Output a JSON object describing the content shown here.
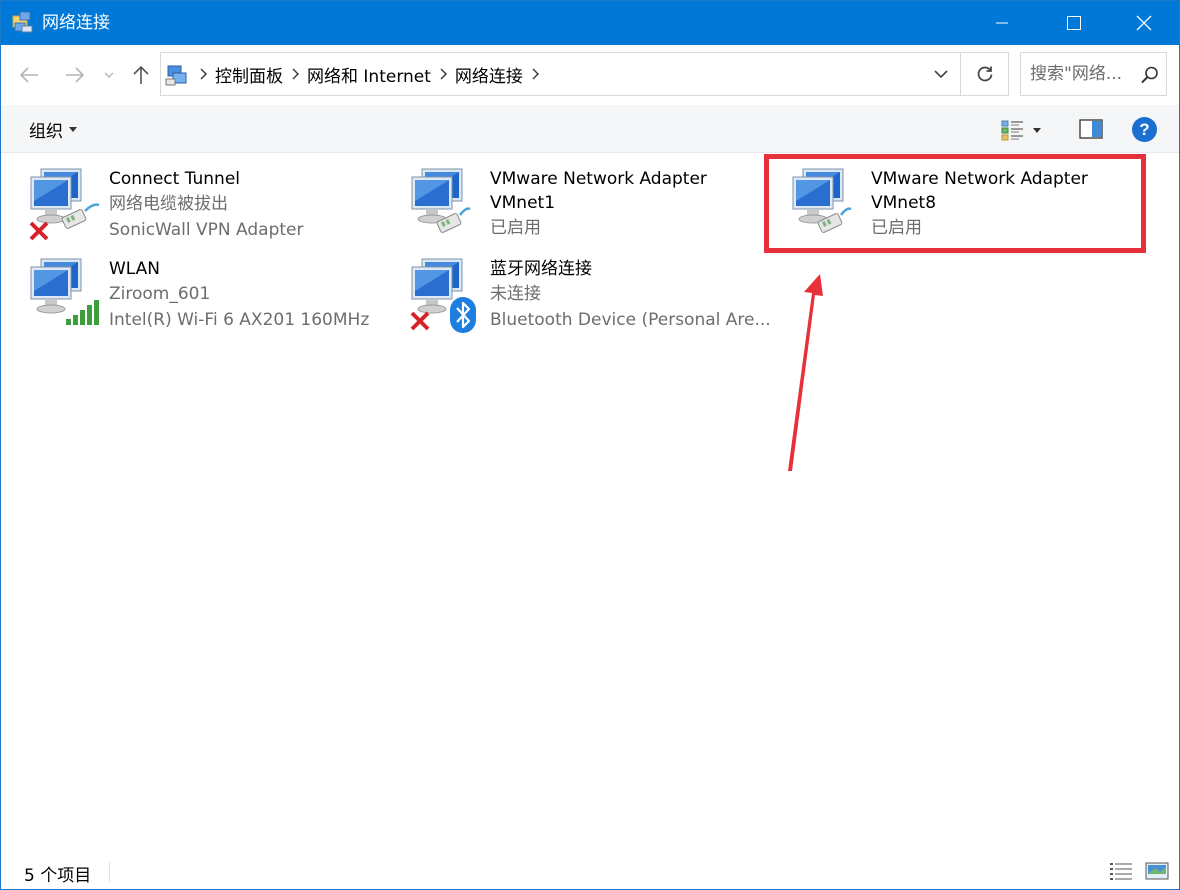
{
  "window": {
    "title": "网络连接"
  },
  "nav": {
    "breadcrumb": [
      "控制面板",
      "网络和 Internet",
      "网络连接"
    ],
    "search_placeholder": "搜索\"网络..."
  },
  "toolbar": {
    "organize_label": "组织",
    "help_label": "?"
  },
  "items": [
    {
      "name": "Connect Tunnel",
      "status": "网络电缆被拔出",
      "device": "SonicWall VPN Adapter",
      "badge": "disconnected-x"
    },
    {
      "name": "VMware Network Adapter VMnet1",
      "status": "",
      "device": "已启用",
      "badge": "none"
    },
    {
      "name": "VMware Network Adapter VMnet8",
      "status": "",
      "device": "已启用",
      "badge": "none"
    },
    {
      "name": "WLAN",
      "status": "Ziroom_601",
      "device": "Intel(R) Wi-Fi 6 AX201 160MHz",
      "badge": "wifi-signal"
    },
    {
      "name": "蓝牙网络连接",
      "status": "未连接",
      "device": "Bluetooth Device (Personal Are...",
      "badge": "bluetooth-x"
    }
  ],
  "status": {
    "count_label": "5 个项目"
  },
  "colors": {
    "titlebar": "#0078d7",
    "highlight": "#e8303a",
    "secondary_text": "#6d6d6d"
  }
}
